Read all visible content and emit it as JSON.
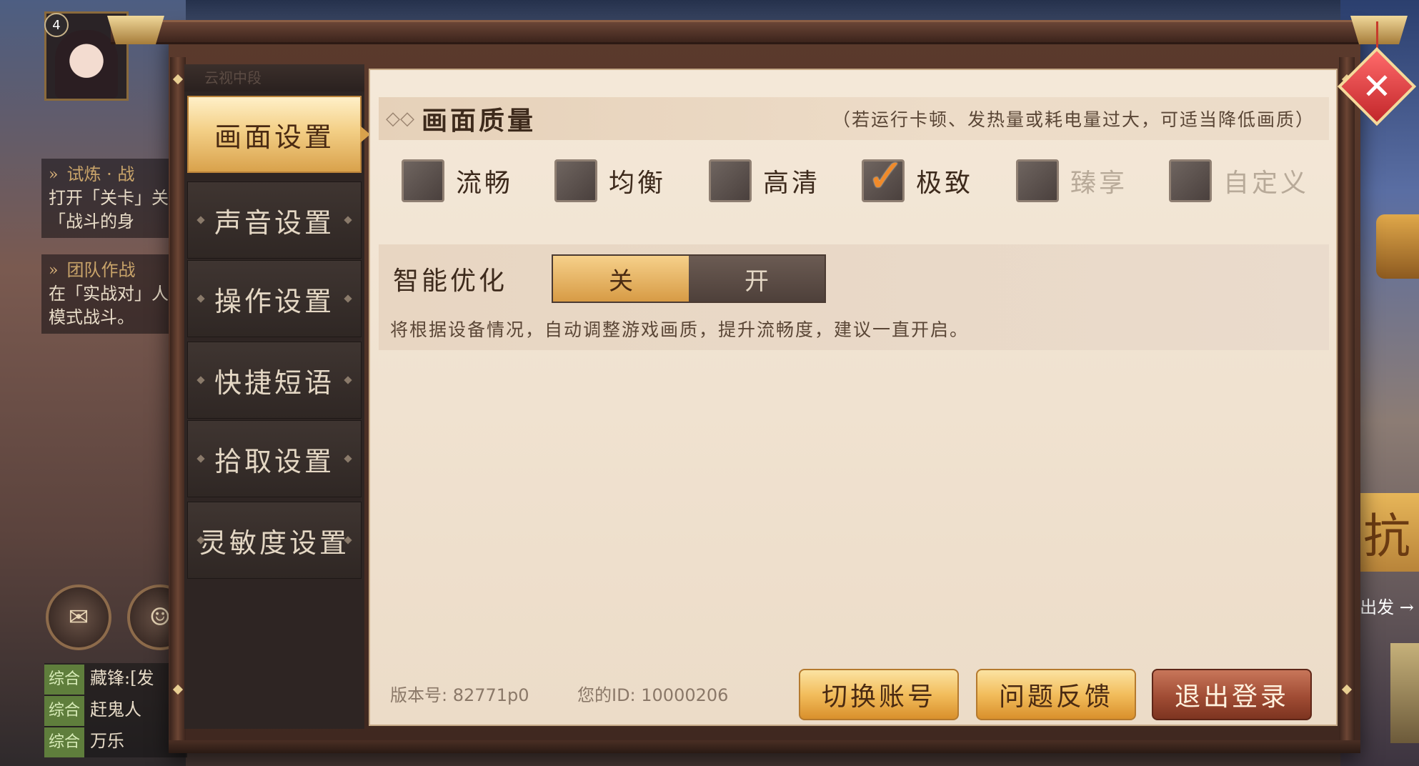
{
  "hud": {
    "player_level": "4",
    "tasks": [
      {
        "title": "试炼 · 战",
        "desc": "打开「关卡」关「战斗的身"
      },
      {
        "title": "团队作战",
        "desc": "在「实战对」人模式战斗。"
      }
    ],
    "chat": [
      {
        "tag": "综合",
        "text": "藏锋:[发"
      },
      {
        "tag": "综合",
        "text": "赶鬼人"
      },
      {
        "tag": "综合",
        "text": "万乐"
      }
    ],
    "right_badge_char": "抗",
    "right_depart_text": "出发 →"
  },
  "tabs": [
    {
      "label": "画面设置",
      "active": true
    },
    {
      "label": "声音设置",
      "active": false
    },
    {
      "label": "操作设置",
      "active": false
    },
    {
      "label": "快捷短语",
      "active": false
    },
    {
      "label": "拾取设置",
      "active": false
    },
    {
      "label": "灵敏度设置",
      "active": false
    }
  ],
  "tab_strip_text": "云视中段",
  "quality": {
    "title": "画面质量",
    "hint": "（若运行卡顿、发热量或耗电量过大，可适当降低画质）",
    "options": [
      {
        "label": "流畅",
        "checked": false,
        "disabled": false
      },
      {
        "label": "均衡",
        "checked": false,
        "disabled": false
      },
      {
        "label": "高清",
        "checked": false,
        "disabled": false
      },
      {
        "label": "极致",
        "checked": true,
        "disabled": false
      },
      {
        "label": "臻享",
        "checked": false,
        "disabled": true
      },
      {
        "label": "自定义",
        "checked": false,
        "disabled": true
      }
    ]
  },
  "smart": {
    "label": "智能优化",
    "off_label": "关",
    "on_label": "开",
    "selected": "off",
    "desc": "将根据设备情况，自动调整游戏画质，提升流畅度，建议一直开启。"
  },
  "footer": {
    "version": "版本号: 82771p0",
    "user_id": "您的ID: 10000206",
    "switch_account": "切换账号",
    "feedback": "问题反馈",
    "logout": "退出登录"
  },
  "colors": {
    "accent_gold": "#f2bd5c",
    "danger_red": "#a04c34",
    "check_orange": "#f08a2a"
  },
  "icons": {
    "close": "close-icon",
    "chevron": "double-chevron-icon",
    "header_deco": "double-diamond-icon"
  }
}
